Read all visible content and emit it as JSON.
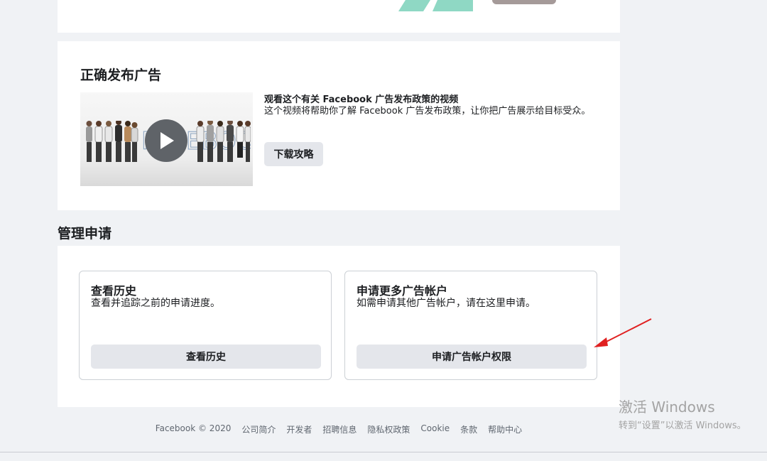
{
  "colors": {
    "accent_green": "#8fd8c4",
    "arrow_red": "#e02020",
    "button_bg": "#e4e6eb"
  },
  "video_section": {
    "title": "正确发布广告",
    "thumbnail_text": "FACEBOOK",
    "video_heading": "观看这个有关 Facebook 广告发布政策的视频",
    "video_description": "这个视频将帮助你了解 Facebook 广告发布政策，让你把广告展示给目标受众。",
    "download_label": "下载攻略"
  },
  "manage": {
    "title": "管理申请",
    "history": {
      "title": "查看历史",
      "description": "查看并追踪之前的申请进度。",
      "button_label": "查看历史"
    },
    "request": {
      "title": "申请更多广告帐户",
      "description": "如需申请其他广告帐户，请在这里申请。",
      "button_label": "申请广告帐户权限"
    }
  },
  "activation": {
    "title": "激活 Windows",
    "subtitle": "转到“设置”以激活 Windows。"
  },
  "footer": {
    "links": [
      "Facebook © 2020",
      "公司简介",
      "开发者",
      "招聘信息",
      "隐私权政策",
      "Cookie",
      "条款",
      "帮助中心"
    ]
  }
}
